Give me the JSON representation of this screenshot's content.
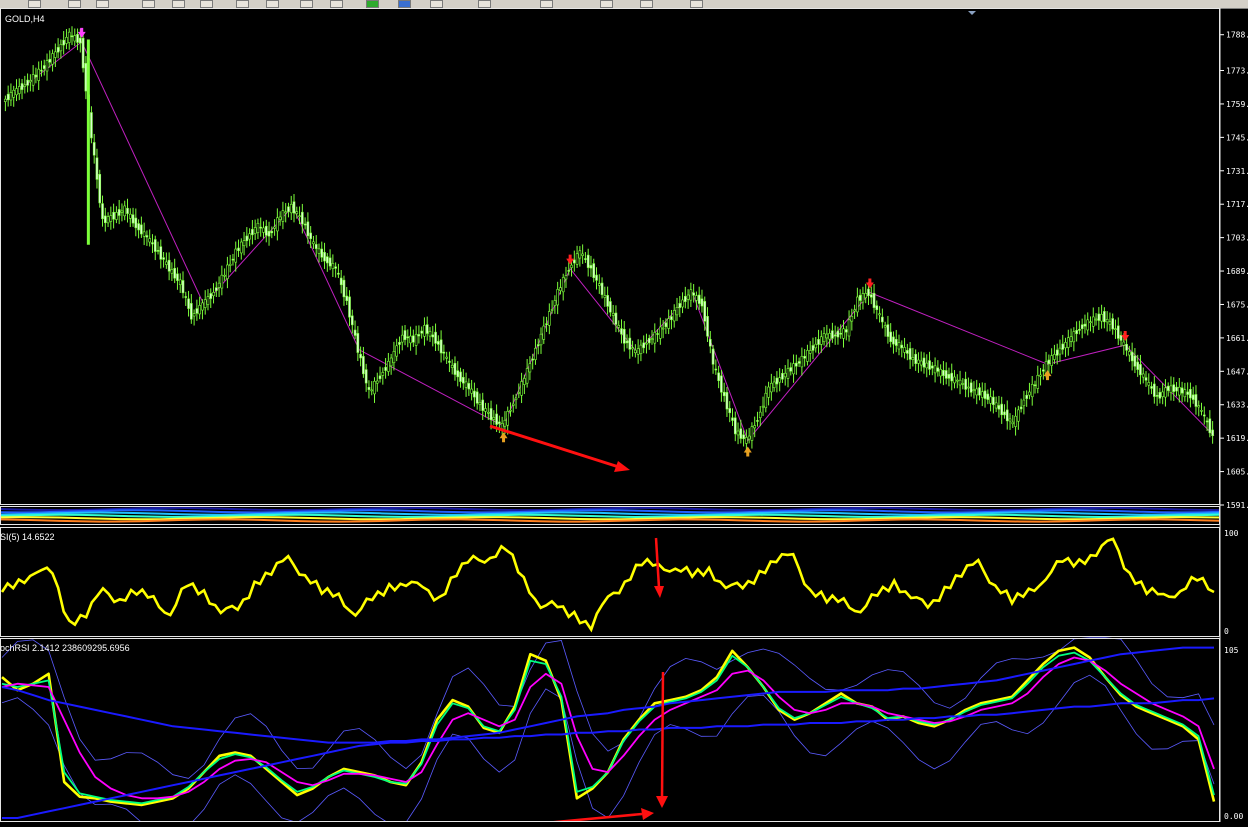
{
  "chart_data": [
    {
      "type": "candlestick",
      "title": "GOLD,H4",
      "y_ticks": [
        "1788",
        "1773",
        "1759",
        "1745",
        "1731",
        "1717",
        "1703",
        "1689",
        "1675",
        "1661",
        "1647",
        "1633",
        "1619",
        "1605",
        "1591"
      ],
      "ylim": [
        1591,
        1795
      ],
      "close": [
        1760,
        1764,
        1767,
        1771,
        1776,
        1782,
        1788,
        1785,
        1745,
        1710,
        1712,
        1715,
        1708,
        1703,
        1697,
        1690,
        1684,
        1670,
        1675,
        1680,
        1688,
        1697,
        1703,
        1708,
        1704,
        1712,
        1716,
        1710,
        1700,
        1694,
        1690,
        1676,
        1656,
        1638,
        1645,
        1652,
        1662,
        1660,
        1665,
        1660,
        1652,
        1645,
        1640,
        1633,
        1628,
        1624,
        1634,
        1644,
        1656,
        1668,
        1680,
        1690,
        1697,
        1690,
        1680,
        1670,
        1660,
        1655,
        1659,
        1663,
        1668,
        1675,
        1680,
        1675,
        1650,
        1636,
        1622,
        1618,
        1627,
        1640,
        1644,
        1648,
        1652,
        1657,
        1662,
        1662,
        1664,
        1677,
        1680,
        1670,
        1660,
        1657,
        1652,
        1650,
        1648,
        1645,
        1643,
        1640,
        1638,
        1635,
        1630,
        1625,
        1635,
        1642,
        1650,
        1655,
        1660,
        1665,
        1668,
        1670,
        1666,
        1658,
        1650,
        1643,
        1636,
        1640,
        1639,
        1637,
        1630,
        1620
      ],
      "down_arrows": [
        7,
        51,
        78,
        101
      ],
      "up_arrows": [
        45,
        67,
        94
      ],
      "annotations": [
        "red trend arrow pointing down-right"
      ]
    },
    {
      "type": "heatmap",
      "note": "compressed color-band indicator panel"
    },
    {
      "type": "line",
      "title": "SI(5) 14.6522",
      "y_ticks": [
        "100",
        "0"
      ],
      "ylim": [
        0,
        100
      ],
      "series": [
        {
          "color": "#ffff00",
          "values": [
            40,
            48,
            65,
            55,
            10,
            20,
            38,
            35,
            40,
            30,
            22,
            45,
            38,
            25,
            18,
            50,
            62,
            70,
            60,
            40,
            33,
            22,
            30,
            45,
            52,
            40,
            36,
            60,
            70,
            78,
            82,
            50,
            30,
            22,
            18,
            8,
            30,
            52,
            70,
            62,
            68,
            55,
            60,
            50,
            40,
            60,
            75,
            72,
            45,
            32,
            28,
            25,
            35,
            48,
            40,
            20,
            45,
            60,
            66,
            50,
            30,
            38,
            58,
            68,
            70,
            82,
            88,
            60,
            42,
            32,
            45,
            52,
            40
          ]
        }
      ]
    },
    {
      "type": "line",
      "title": "ochRSI 2.1412 238609295.6956",
      "y_ticks": [
        "105",
        "0.00"
      ],
      "ylim": [
        0,
        105
      ],
      "series": [
        {
          "color": "#ffff00",
          "values": [
            86,
            78,
            82,
            88,
            22,
            13,
            12,
            10,
            9,
            8,
            10,
            12,
            18,
            28,
            38,
            40,
            38,
            30,
            22,
            14,
            18,
            25,
            30,
            28,
            26,
            22,
            20,
            34,
            60,
            72,
            68,
            55,
            52,
            68,
            100,
            96,
            72,
            12,
            18,
            28,
            48,
            60,
            70,
            72,
            74,
            78,
            86,
            102,
            92,
            80,
            66,
            60,
            64,
            70,
            76,
            70,
            68,
            60,
            62,
            58,
            56,
            60,
            66,
            70,
            72,
            74,
            84,
            94,
            102,
            104,
            98,
            86,
            75,
            68,
            64,
            60,
            56,
            48,
            10
          ]
        },
        {
          "color": "#00ff7f",
          "values": [
            82,
            80,
            82,
            84,
            28,
            15,
            13,
            11,
            10,
            9,
            11,
            13,
            19,
            28,
            36,
            39,
            37,
            31,
            23,
            16,
            19,
            25,
            29,
            27,
            25,
            22,
            21,
            33,
            57,
            70,
            67,
            56,
            53,
            66,
            96,
            94,
            74,
            16,
            19,
            28,
            47,
            59,
            68,
            71,
            73,
            77,
            84,
            99,
            92,
            80,
            67,
            61,
            64,
            69,
            74,
            70,
            67,
            61,
            62,
            59,
            57,
            60,
            65,
            69,
            71,
            73,
            82,
            92,
            99,
            101,
            96,
            86,
            76,
            69,
            65,
            61,
            57,
            50,
            14
          ]
        },
        {
          "color": "#ff00ff",
          "values": [
            80,
            82,
            81,
            80,
            60,
            40,
            25,
            18,
            14,
            12,
            12,
            13,
            16,
            22,
            30,
            35,
            36,
            34,
            28,
            22,
            20,
            23,
            27,
            27,
            26,
            24,
            22,
            28,
            45,
            60,
            64,
            60,
            56,
            60,
            80,
            88,
            82,
            50,
            30,
            28,
            38,
            50,
            60,
            66,
            70,
            74,
            78,
            88,
            90,
            84,
            74,
            66,
            64,
            66,
            70,
            70,
            68,
            64,
            62,
            60,
            58,
            59,
            62,
            66,
            68,
            70,
            76,
            86,
            94,
            98,
            96,
            90,
            82,
            76,
            70,
            66,
            62,
            56,
            30
          ]
        },
        {
          "color": "#1a1aff",
          "values": [
            80,
            78,
            75,
            72,
            70,
            68,
            66,
            64,
            62,
            60,
            58,
            56,
            55,
            54,
            53,
            52,
            51,
            50,
            49,
            48,
            47,
            46,
            46,
            46,
            46,
            47,
            47,
            48,
            48,
            49,
            50,
            51,
            52,
            54,
            56,
            58,
            60,
            62,
            63,
            64,
            66,
            67,
            68,
            70,
            71,
            72,
            73,
            74,
            75,
            76,
            77,
            77,
            77,
            77,
            78,
            78,
            78,
            78,
            79,
            79,
            80,
            81,
            82,
            83,
            84,
            86,
            88,
            90,
            92,
            94,
            96,
            98,
            100,
            101,
            102,
            103,
            104,
            104,
            104
          ]
        },
        {
          "color": "#1a1aff",
          "values": [
            0,
            0,
            2,
            4,
            6,
            8,
            10,
            12,
            14,
            16,
            18,
            20,
            22,
            24,
            26,
            28,
            30,
            32,
            34,
            36,
            38,
            40,
            42,
            44,
            45,
            46,
            46,
            47,
            47,
            48,
            48,
            49,
            49,
            50,
            50,
            51,
            51,
            52,
            52,
            53,
            53,
            54,
            54,
            55,
            55,
            55,
            56,
            56,
            56,
            57,
            57,
            57,
            58,
            58,
            58,
            59,
            59,
            60,
            60,
            61,
            61,
            62,
            62,
            63,
            63,
            64,
            65,
            66,
            67,
            68,
            68,
            69,
            70,
            70,
            70,
            71,
            72,
            72,
            73
          ]
        }
      ]
    }
  ]
}
